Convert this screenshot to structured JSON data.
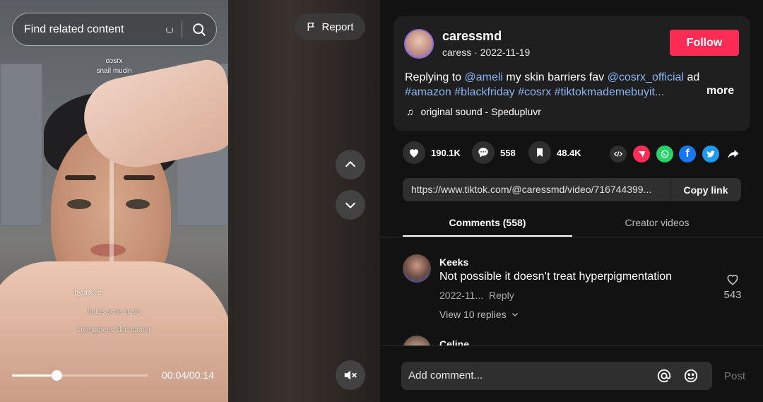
{
  "search": {
    "placeholder": "Find related content"
  },
  "video": {
    "overlay_top_1": "cosrx",
    "overlay_top_2": "snail mucin",
    "overlay_bottom_1": "hydrates",
    "overlay_bottom_2": "fades acne scars",
    "overlay_bottom_3": "strengthens skin barrier",
    "time": "00:04/00:14",
    "progress": 0.33
  },
  "report": {
    "label": "Report"
  },
  "post": {
    "username": "caressmd",
    "display_name": "caress",
    "date": "2022-11-19",
    "follow_label": "Follow",
    "desc_replying": "Replying to ",
    "desc_mention1": "@ameli",
    "desc_mid": " my skin barriers fav ",
    "desc_mention2": "@cosrx_official",
    "desc_ad": " ad",
    "desc_hashtags": "#amazon #blackfriday #cosrx #tiktokmademebuyit...",
    "more_label": "more",
    "music": "original sound - Spedupluvr"
  },
  "stats": {
    "likes": "190.1K",
    "comments": "558",
    "saves": "48.4K"
  },
  "share": {
    "url": "https://www.tiktok.com/@caressmd/video/716744399...",
    "copy_label": "Copy link"
  },
  "tabs": {
    "comments": "Comments (558)",
    "creator": "Creator videos"
  },
  "comments": [
    {
      "name": "Keeks",
      "text": "Not possible it doesn’t treat hyperpigmentation",
      "date": "2022-11...",
      "reply": "Reply",
      "likes": "543",
      "view_replies": "View 10 replies"
    },
    {
      "name": "Celine"
    }
  ],
  "comment_bar": {
    "placeholder": "Add comment...",
    "post_label": "Post"
  },
  "colors": {
    "accent": "#fe2c55",
    "link": "#8ab4f8",
    "whatsapp": "#25d366",
    "facebook": "#1877f2",
    "twitter": "#1d9bf0",
    "send": "#fe2c55"
  }
}
